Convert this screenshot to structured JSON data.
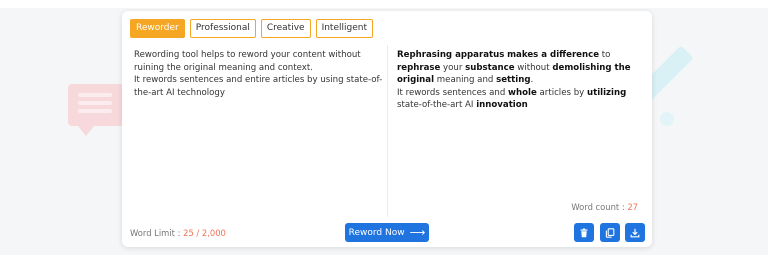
{
  "modes": [
    {
      "label": "Reworder",
      "active": true
    },
    {
      "label": "Professional",
      "active": false
    },
    {
      "label": "Creative",
      "active": false
    },
    {
      "label": "Intelligent",
      "active": false
    }
  ],
  "input": {
    "line1": "Rewording tool helps to reword your content without ruining the original meaning and context.",
    "line2": "It rewords sentences and entire articles by using state-of-the-art AI technology"
  },
  "output": {
    "s1": "Rephrasing apparatus",
    "s2": "makes a difference",
    "s3": " to ",
    "s4": "rephrase",
    "s5": " your ",
    "s6": "substance",
    "s7": " without ",
    "s8": "demolishing the original",
    "s9": " meaning and ",
    "s10": "setting",
    "s11": ".",
    "s12": "It rewords sentences and ",
    "s13": "whole",
    "s14": " articles by ",
    "s15": "utilizing",
    "s16": " state-of-the-art AI ",
    "s17": "innovation"
  },
  "word_count": {
    "label": "Word count : ",
    "value": "27"
  },
  "word_limit": {
    "label": "Word Limit : ",
    "value": "25 / 2,000"
  },
  "reword_button": {
    "label": "Reword Now"
  },
  "icons": {
    "delete": "trash-icon",
    "copy": "copy-icon",
    "download": "download-icon"
  },
  "colors": {
    "accent": "#f5a623",
    "primary": "#1f74e0",
    "count": "#f07355"
  }
}
